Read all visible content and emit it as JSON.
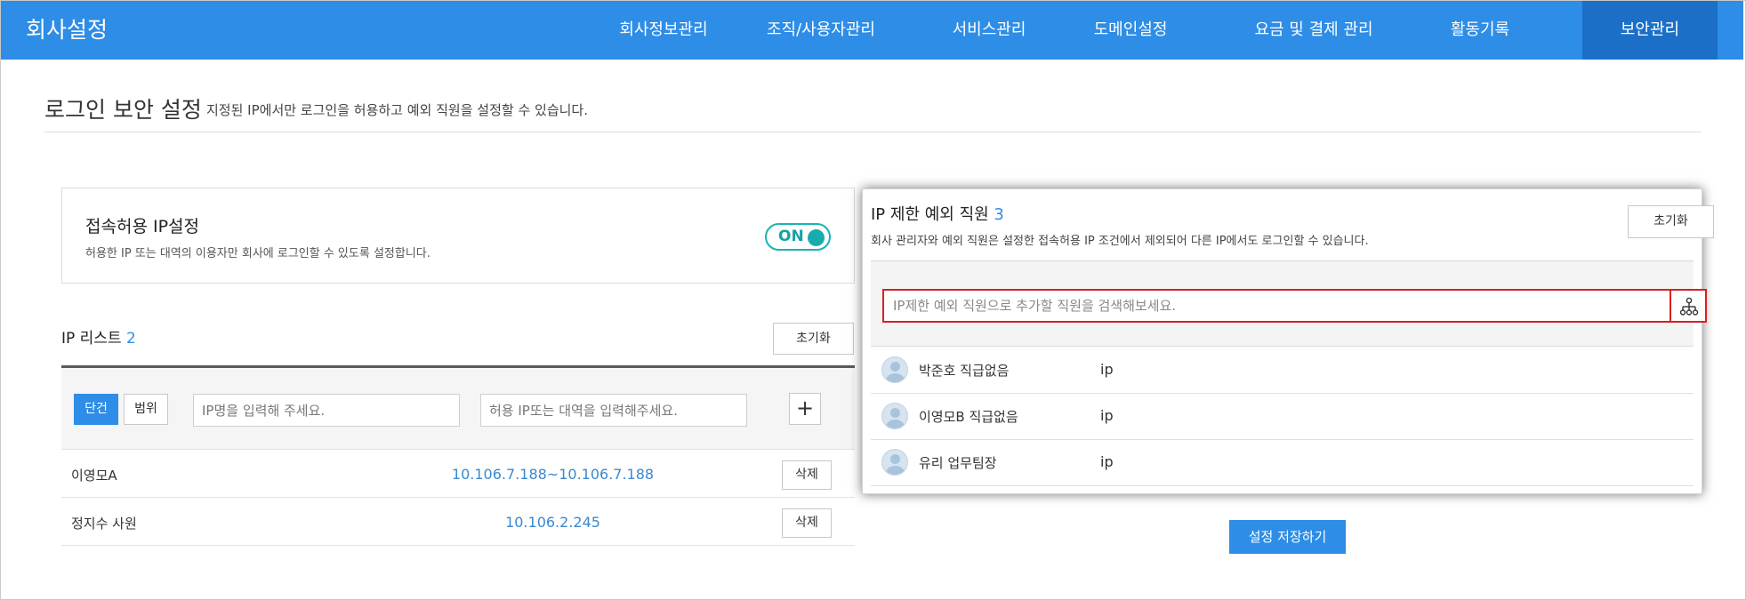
{
  "app": {
    "title": "회사설정"
  },
  "nav": {
    "items": [
      {
        "label": "회사정보관리"
      },
      {
        "label": "조직/사용자관리"
      },
      {
        "label": "서비스관리"
      },
      {
        "label": "도메인설정"
      },
      {
        "label": "요금 및 결제 관리"
      },
      {
        "label": "활동기록"
      },
      {
        "label": "보안관리",
        "active": true
      }
    ]
  },
  "page": {
    "title": "로그인 보안 설정",
    "description": "지정된 IP에서만 로그인을 허용하고 예외 직원을 설정할 수 있습니다."
  },
  "access_ip": {
    "title": "접속허용 IP설정",
    "description": "허용한 IP 또는 대역의 이용자만 회사에 로그인할 수 있도록 설정합니다.",
    "toggle_label": "ON"
  },
  "ip_list": {
    "title": "IP 리스트",
    "count": "2",
    "reset_label": "초기화",
    "mode_single": "단건",
    "mode_range": "범위",
    "name_placeholder": "IP명을 입력해 주세요.",
    "ip_placeholder": "허용 IP또는 대역을 입력해주세요.",
    "add_label": "+",
    "rows": [
      {
        "name": "이영모A",
        "ip": "10.106.7.188~10.106.7.188",
        "delete_label": "삭제"
      },
      {
        "name": "정지수 사원",
        "ip": "10.106.2.245",
        "delete_label": "삭제"
      }
    ]
  },
  "exceptions": {
    "title": "IP 제한 예외 직원",
    "count": "3",
    "description": "회사 관리자와 예외 직원은 설정한 접속허용 IP 조건에서 제외되어 다른 IP에서도 로그인할 수 있습니다.",
    "reset_label": "초기화",
    "search_placeholder": "IP제한 예외 직원으로 추가할 직원을 검색해보세요.",
    "rows": [
      {
        "name": "박준호 직급없음",
        "ip": "ip"
      },
      {
        "name": "이영모B 직급없음",
        "ip": "ip"
      },
      {
        "name": "유리 업무팀장",
        "ip": "ip"
      }
    ]
  },
  "save_label": "설정 저장하기",
  "colors": {
    "primary": "#2e8de6",
    "nav_active": "#1c6fc6",
    "toggle_teal": "#17adad",
    "link_blue": "#3a88cf",
    "search_border_red": "#d9201f"
  }
}
